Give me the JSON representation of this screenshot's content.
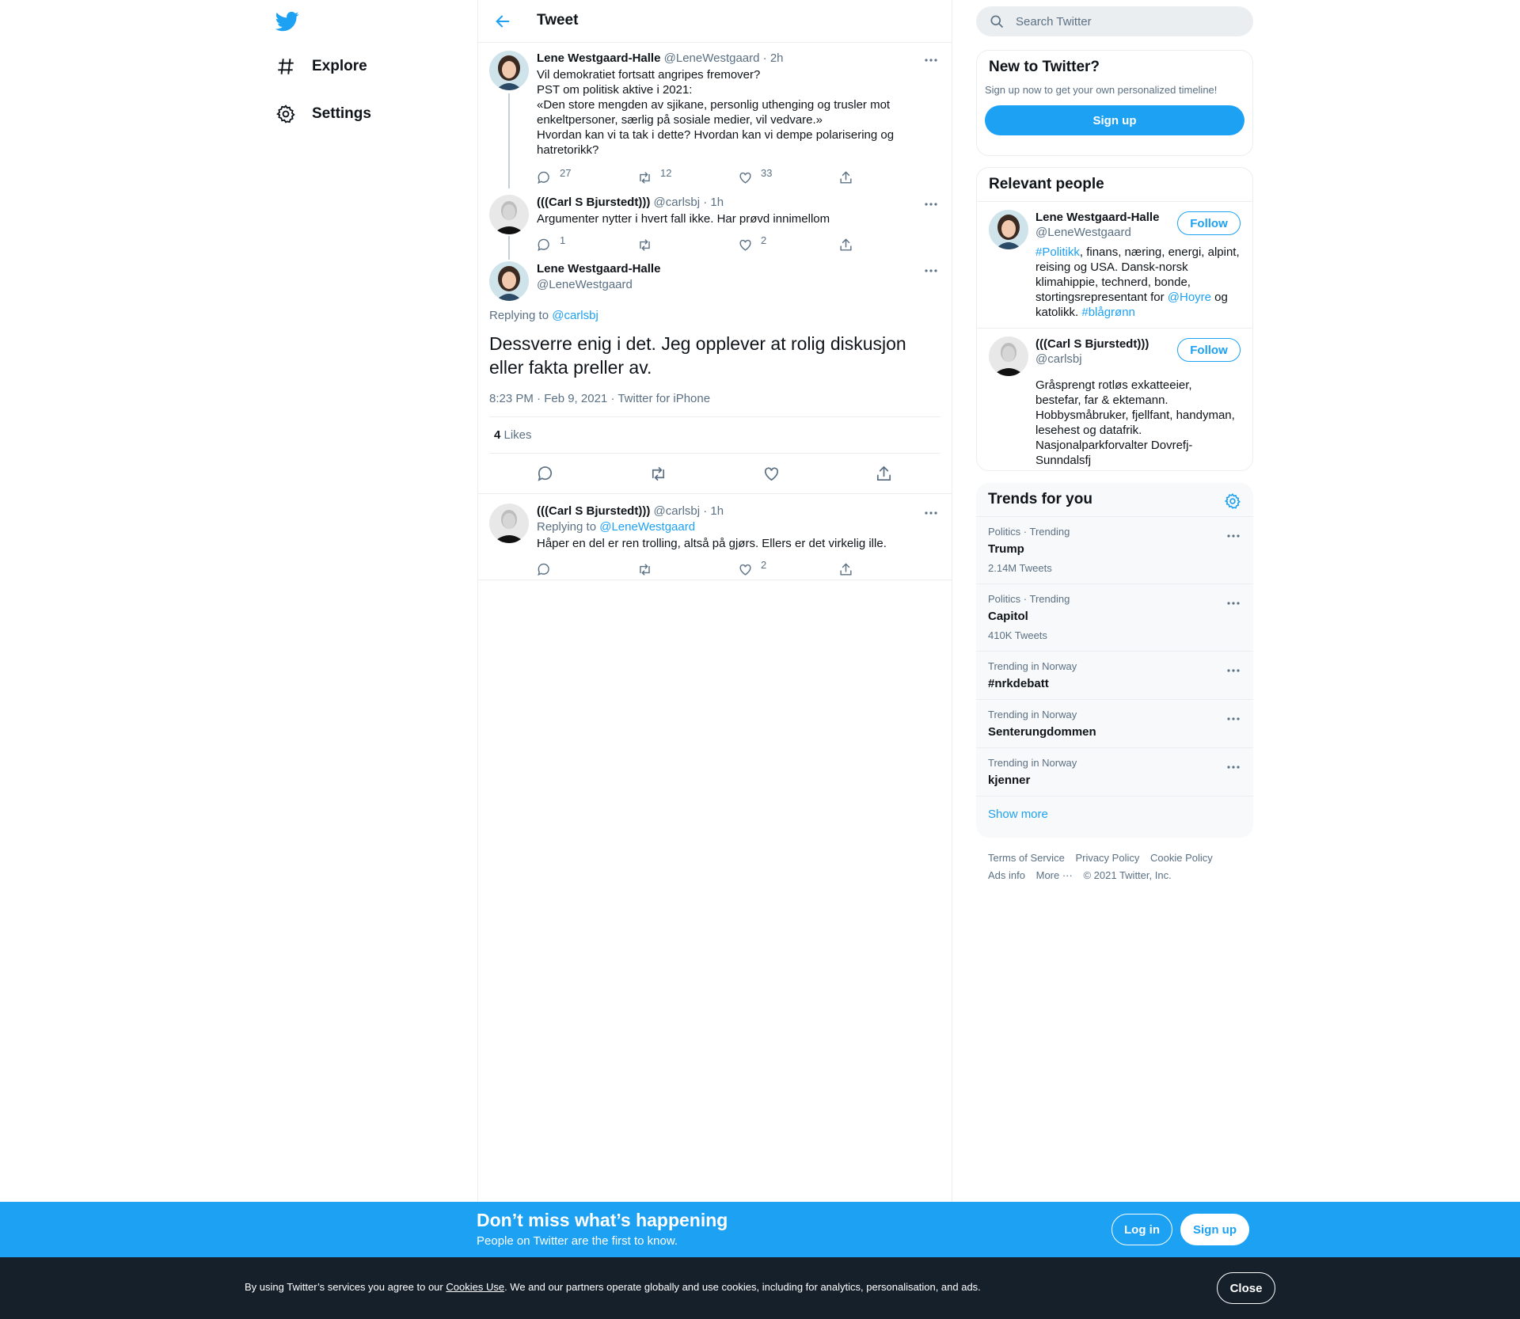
{
  "nav": {
    "items": [
      {
        "label": "Explore",
        "icon": "hashtag-icon"
      },
      {
        "label": "Settings",
        "icon": "gear-icon"
      }
    ]
  },
  "header": {
    "title": "Tweet"
  },
  "thread": [
    {
      "name": "Lene Westgaard-Halle",
      "handle": "@LeneWestgaard",
      "time": "· 2h",
      "lines": [
        "Vil demokratiet fortsatt angripes fremover?",
        "PST om politisk aktive i 2021:",
        "«Den store mengden av sjikane, personlig uthenging og trusler mot enkeltpersoner, særlig på sosiale medier, vil vedvare.»",
        "Hvordan kan vi ta tak i dette? Hvordan kan vi dempe polarisering og hatretorikk?"
      ],
      "replies": "27",
      "retweets": "12",
      "likes": "33"
    },
    {
      "name": "(((Carl S Bjurstedt)))",
      "handle": "@carlsbj",
      "time": "· 1h",
      "lines": [
        "Argumenter nytter i hvert fall ikke. Har prøvd innimellom"
      ],
      "replies": "1",
      "retweets": "",
      "likes": "2"
    }
  ],
  "main_tweet": {
    "name": "Lene Westgaard-Halle",
    "handle": "@LeneWestgaard",
    "replying_prefix": "Replying to ",
    "replying_to": "@carlsbj",
    "text": "Dessverre enig i det. Jeg opplever at rolig diskusjon eller fakta preller av.",
    "time": "8:23 PM · Feb 9, 2021",
    "source": "Twitter for iPhone",
    "likes_count": "4",
    "likes_label": " Likes"
  },
  "reply": {
    "name": "(((Carl S Bjurstedt)))",
    "handle": "@carlsbj",
    "time": "· 1h",
    "replying_prefix": "Replying to ",
    "replying_to": "@LeneWestgaard",
    "text": "Håper en del er ren trolling, altså på gjørs. Ellers er det virkelig ille.",
    "replies": "",
    "retweets": "",
    "likes": "2"
  },
  "search": {
    "placeholder": "Search Twitter"
  },
  "new_to_twitter": {
    "title": "New to Twitter?",
    "subtitle": "Sign up now to get your own personalized timeline!",
    "button": "Sign up"
  },
  "relevant_people": {
    "title": "Relevant people",
    "follow_label": "Follow",
    "people": [
      {
        "name": "Lene Westgaard-Halle",
        "handle": "@LeneWestgaard",
        "bio": {
          "tag1": "#Politikk",
          "text1": ", finans, næring, energi, alpint, reising og USA. Dansk-norsk klimahippie, technerd, bonde, stortingsrepresentant for ",
          "mention": "@Hoyre",
          "text2": " og katolikk. ",
          "tag2": "#blågrønn"
        }
      },
      {
        "name": "(((Carl S Bjurstedt)))",
        "handle": "@carlsbj",
        "bio_text": "Gråsprengt rotløs exkatteeier, bestefar, far & ektemann. Hobbysmåbruker, fjellfant, handyman, lesehest og datafrik. Nasjonalparkforvalter Dovrefj-Sunndalsfj"
      }
    ]
  },
  "trends": {
    "title": "Trends for you",
    "items": [
      {
        "meta": "Politics · Trending",
        "name": "Trump",
        "count": "2.14M Tweets"
      },
      {
        "meta": "Politics · Trending",
        "name": "Capitol",
        "count": "410K Tweets"
      },
      {
        "meta": "Trending in Norway",
        "name": "#nrkdebatt",
        "count": ""
      },
      {
        "meta": "Trending in Norway",
        "name": "Senterungdommen",
        "count": ""
      },
      {
        "meta": "Trending in Norway",
        "name": "kjenner",
        "count": ""
      }
    ],
    "show_more": "Show more"
  },
  "footer": {
    "links": [
      "Terms of Service",
      "Privacy Policy",
      "Cookie Policy",
      "Ads info",
      "More ···"
    ],
    "copyright": "© 2021 Twitter, Inc."
  },
  "banner": {
    "title": "Don’t miss what’s happening",
    "subtitle": "People on Twitter are the first to know.",
    "login": "Log in",
    "signup": "Sign up"
  },
  "cookie": {
    "before": "By using Twitter’s services you agree to our ",
    "link": "Cookies Use",
    "after": ". We and our partners operate globally and use cookies, including for analytics, personalisation, and ads.",
    "close": "Close"
  },
  "colors": {
    "accent": "#1da1f2",
    "text": "#0f1419",
    "secondary": "#5b7083",
    "border": "#ebeef0",
    "cookie_bg": "#15202b"
  }
}
